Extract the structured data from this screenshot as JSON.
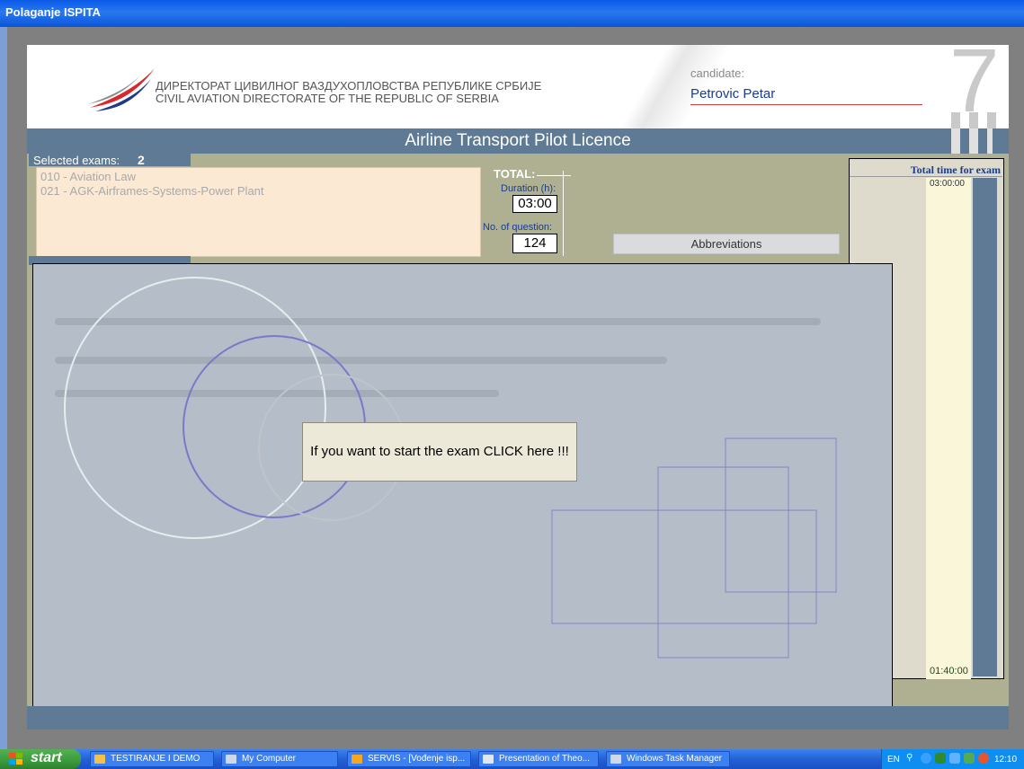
{
  "window": {
    "title": "Polaganje ISPITA"
  },
  "header": {
    "org_serbian": "ДИРЕКТОРАТ ЦИВИЛНОГ ВАЗДУХОПЛОВСТВА РЕПУБЛИКЕ СРБИЈЕ",
    "org_english": "CIVIL AVIATION DIRECTORATE OF THE REPUBLIC OF SERBIA",
    "candidate_label": "candidate:",
    "candidate_name": "Petrovic Petar",
    "big_digit": "7"
  },
  "licence": {
    "title": "Airline Transport Pilot Licence"
  },
  "exams": {
    "selected_label": "Selected exams:",
    "selected_count": "2",
    "items": [
      "010 - Aviation Law",
      "021 - AGK-Airframes-Systems-Power Plant"
    ]
  },
  "totals": {
    "label": "TOTAL:",
    "duration_label": "Duration (h):",
    "duration_value": "03:00",
    "questions_label": "No. of question:",
    "questions_value": "124"
  },
  "abbreviations": {
    "label": "Abbreviations"
  },
  "timer": {
    "title": "Total time for exam",
    "start": "03:00:00",
    "end": "01:40:00"
  },
  "main": {
    "start_button": "If you want to start the exam CLICK here !!!"
  },
  "taskbar": {
    "start_label": "start",
    "tasks": [
      "TESTIRANJE I DEMO",
      "My Computer",
      "SERVIS - [Vođenje isp...",
      "Presentation of Theo...",
      "Windows Task Manager"
    ],
    "language": "EN",
    "clock": "12:10"
  },
  "colors": {
    "header_bar": "#5f7a94",
    "panel_olive": "#aeb091",
    "canvas": "#b4bdc8",
    "xp_blue": "#2461d6",
    "start_green": "#3b9a3b"
  }
}
